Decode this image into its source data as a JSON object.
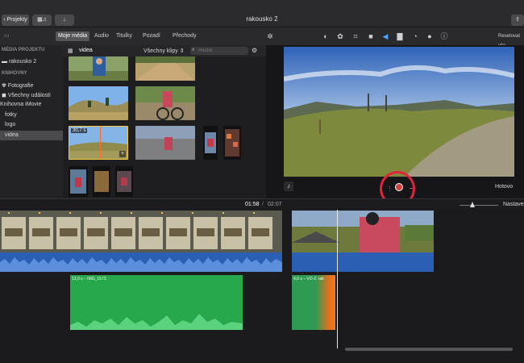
{
  "window": {
    "title": "rakousko 2",
    "projects_button": "Projekty"
  },
  "tabs": [
    {
      "label": "Moje média",
      "active": true
    },
    {
      "label": "Audio",
      "active": false
    },
    {
      "label": "Titulky",
      "active": false
    },
    {
      "label": "Pozadí",
      "active": false
    },
    {
      "label": "Přechody",
      "active": false
    }
  ],
  "toolbar": {
    "reset_label": "Resetovat vše"
  },
  "sidebar": {
    "project_heading": "MÉDIA PROJEKTU",
    "project_item": "rakousko 2",
    "libraries_heading": "KNIHOVNY",
    "library_items": [
      "Fotografie",
      "Všechny události"
    ],
    "imovie_library": "Knihovna iMovie",
    "events": [
      "fotky",
      "logo",
      "videa"
    ],
    "selected_event": "videa"
  },
  "browser": {
    "event_title": "videa",
    "filter_label": "Všechny klipy",
    "search_placeholder": "Hledat",
    "selected_clip_duration": "30,7 s"
  },
  "viewer": {
    "done_label": "Hotovo"
  },
  "timeline": {
    "current_time": "01:58",
    "separator": "/",
    "total_time": "02:07",
    "settings_label": "Nastave",
    "audio_clip_1_label": "13,0 s – IMG_1573",
    "audio_clip_2_label": "4,0 s – VO-2: rak"
  },
  "colors": {
    "accent": "#1a82e6",
    "audio_green": "#27a84c",
    "audio_blue": "#2a5fb3",
    "highlight_red": "#e2233b",
    "selection_yellow": "#f2c744"
  },
  "icons": {
    "color_balance": "color-balance-icon",
    "color_correction": "palette-icon",
    "crop": "crop-icon",
    "stabilization": "camera-icon",
    "volume": "speaker-icon",
    "noise_reduction": "equalizer-icon",
    "speed": "speedometer-icon",
    "filter": "filter-icon",
    "info": "info-icon"
  }
}
